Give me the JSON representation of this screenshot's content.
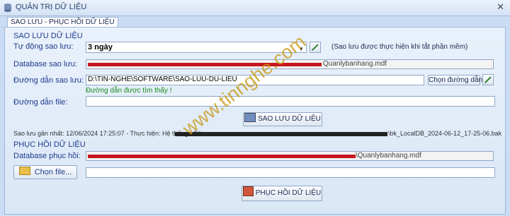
{
  "window": {
    "title": "QUẢN TRỊ DỮ LIỆU"
  },
  "tabs": [
    {
      "label": "SAO LƯU - PHỤC HỒI DỮ LIỆU"
    }
  ],
  "backup": {
    "section_title": "SAO LƯU DỮ LIỆU",
    "auto_label": "Tự động sao lưu:",
    "auto_value": "3 ngày",
    "auto_note": "(Sao lưu được thực hiện khi tắt phần mềm)",
    "database_label": "Database sao lưu:",
    "database_suffix": "Quanlybanhang.mdf",
    "path_label": "Đường dẫn sao lưu:",
    "path_value": "D:\\TIN-NGHE\\SOFTWARE\\SAO-LUU-DU-LIEU",
    "path_found": "Đường dẫn được tìm thấy !",
    "choose_path_button": "Chọn đường dẫn...",
    "file_path_label": "Đường dẫn file:",
    "file_path_value": "",
    "backup_button": "SAO LƯU DỮ LIỆU",
    "last_backup_text": "Sao lưu gần nhất: 12/06/2024 17:25:07 - Thực hiện: Hệ thống - File:",
    "last_backup_file": "\\bk_LocalDB_2024-06-12_17-25-06.bak"
  },
  "restore": {
    "section_title": "PHỤC HỒI DỮ LIỆU",
    "database_label": "Database phục hồi:",
    "database_suffix": "\\Quanlybanhang.mdf",
    "choose_file_button": "Chọn file...",
    "file_value": "",
    "restore_button": "PHỤC HỒI DỮ LIỆU"
  },
  "watermark": "www.tinnghe.com",
  "colors": {
    "label": "#1c3a8c",
    "success": "#1a8a1a",
    "redaction": "#c4161c",
    "watermark": "#c99a1a"
  }
}
